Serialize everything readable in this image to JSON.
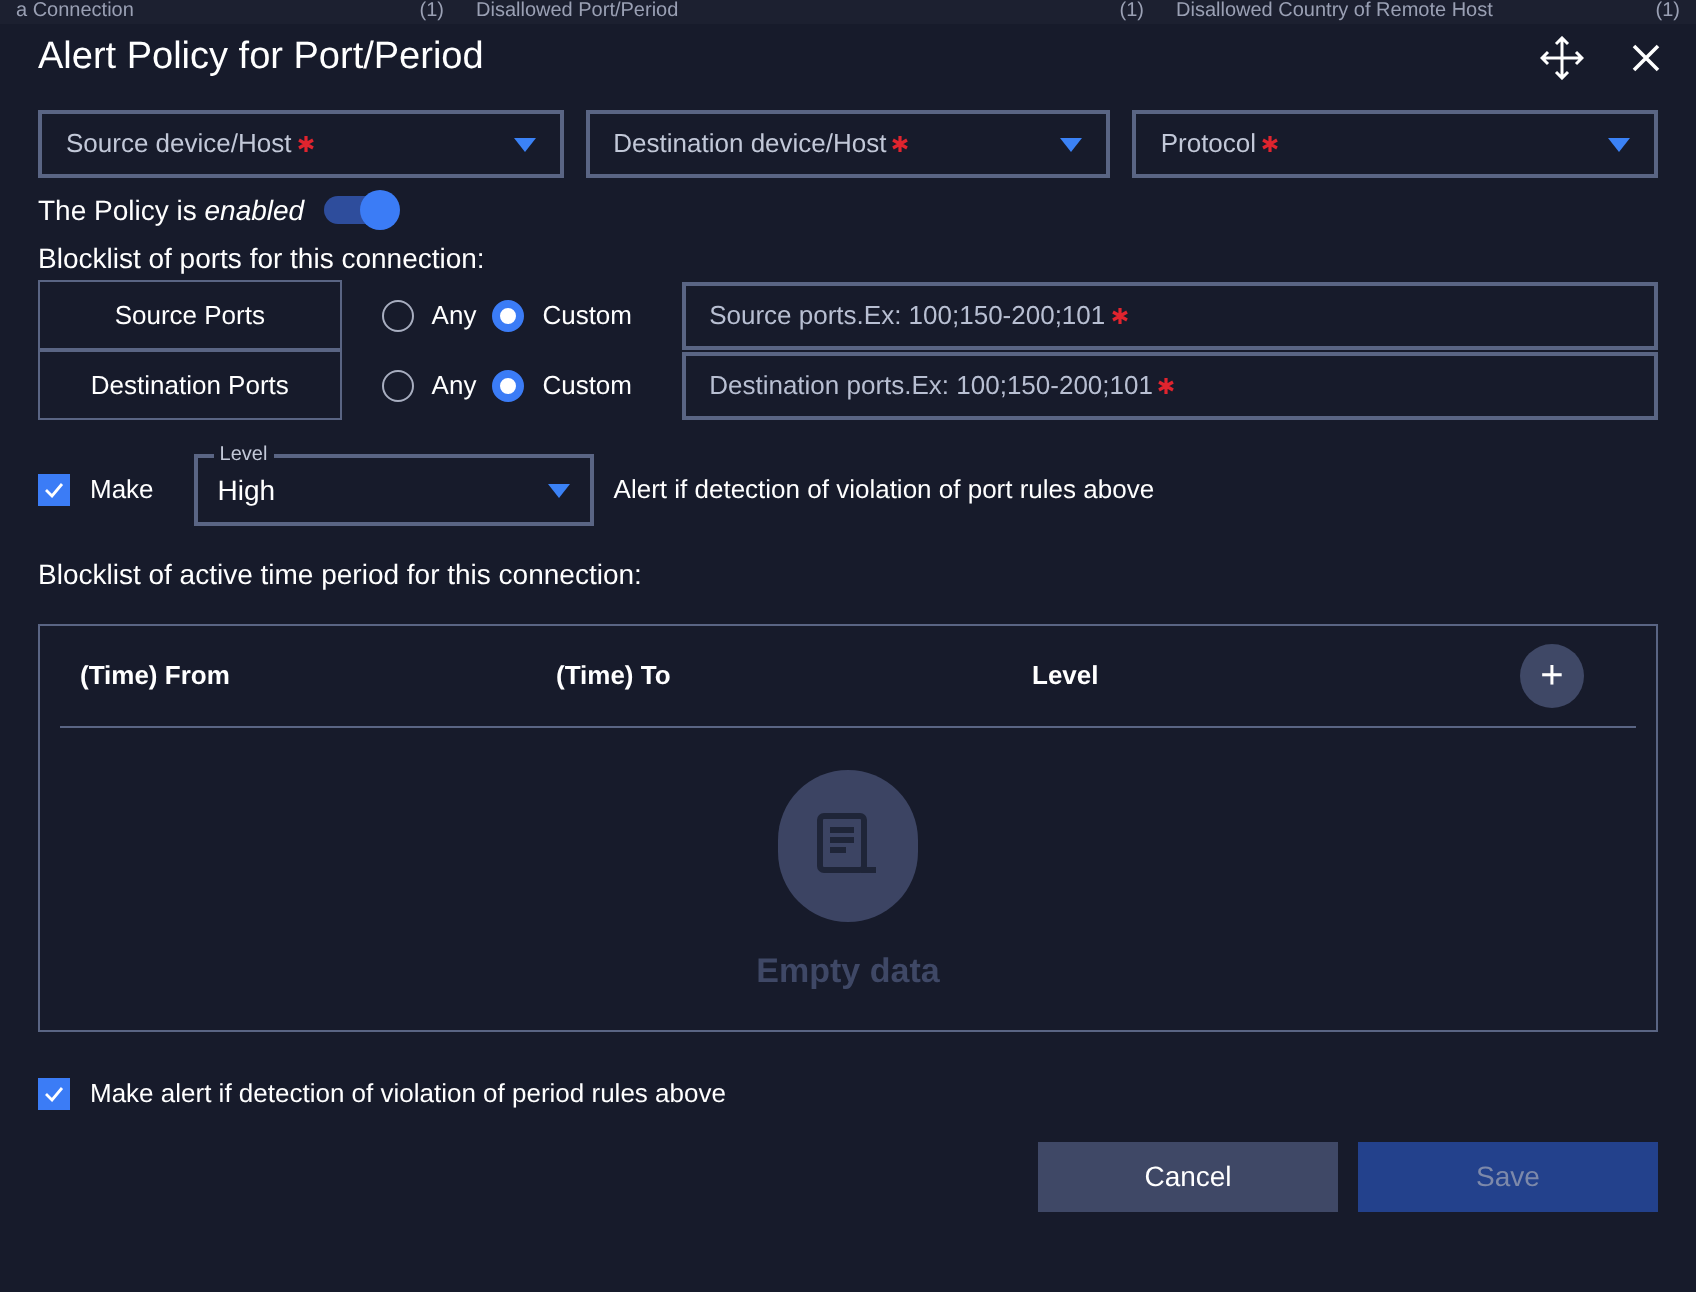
{
  "background_tabs": [
    {
      "label": "a Connection",
      "count": "(1)"
    },
    {
      "label": "Disallowed Port/Period",
      "count": "(1)"
    },
    {
      "label": "Disallowed Country of Remote Host",
      "count": "(1)"
    }
  ],
  "dialog": {
    "title": "Alert Policy for Port/Period"
  },
  "selects": [
    {
      "placeholder": "Source device/Host",
      "required": true
    },
    {
      "placeholder": "Destination device/Host",
      "required": true
    },
    {
      "placeholder": "Protocol",
      "required": true
    }
  ],
  "policy": {
    "label": "The Policy is",
    "state_text": "enabled",
    "on": true
  },
  "ports_heading": "Blocklist of ports for this connection:",
  "port_rows": [
    {
      "label": "Source Ports",
      "options": [
        {
          "label": "Any",
          "selected": false
        },
        {
          "label": "Custom",
          "selected": true
        }
      ],
      "placeholder": "Source ports.Ex: 100;150-200;101",
      "required": true
    },
    {
      "label": "Destination Ports",
      "options": [
        {
          "label": "Any",
          "selected": false
        },
        {
          "label": "Custom",
          "selected": true
        }
      ],
      "placeholder": "Destination ports.Ex: 100;150-200;101",
      "required": true
    }
  ],
  "port_alert": {
    "checkbox_label": "Make",
    "checked": true,
    "level_label": "Level",
    "level_value": "High",
    "suffix": "Alert if detection of violation of port rules above"
  },
  "period_heading": "Blocklist of active time period for this connection:",
  "table": {
    "columns": [
      "(Time) From",
      "(Time) To",
      "Level"
    ],
    "add_button": "+",
    "empty_text": "Empty data"
  },
  "period_alert": {
    "label": "Make alert if detection of violation of period rules above",
    "checked": true
  },
  "buttons": [
    {
      "label": "Cancel",
      "kind": "secondary",
      "disabled": false
    },
    {
      "label": "Save",
      "kind": "primary",
      "disabled": true
    }
  ]
}
